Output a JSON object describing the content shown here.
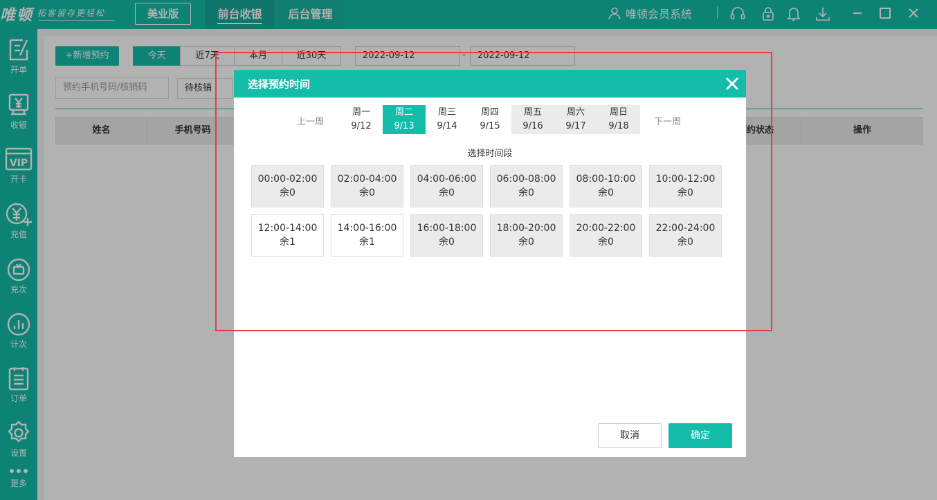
{
  "topbar": {
    "logo": "唯顿",
    "slogan": "拓客留存更轻松",
    "edition": "美业版",
    "tabs": [
      {
        "label": "前台收银"
      },
      {
        "label": "后台管理"
      }
    ],
    "system_name": "唯顿会员系统",
    "icons": [
      "headset-icon",
      "lock-icon",
      "bell-icon",
      "download-icon",
      "minimize-icon",
      "maximize-icon",
      "close-icon"
    ]
  },
  "sidebar": {
    "items": [
      {
        "label": "开单",
        "icon": "edit-order-icon"
      },
      {
        "label": "收银",
        "icon": "cash-register-icon"
      },
      {
        "label": "开卡",
        "icon": "vip-card-icon"
      },
      {
        "label": "充值",
        "icon": "recharge-icon"
      },
      {
        "label": "充次",
        "icon": "recharge-times-icon"
      },
      {
        "label": "计次",
        "icon": "bar-chart-icon"
      },
      {
        "label": "订单",
        "icon": "order-list-icon"
      },
      {
        "label": "设置",
        "icon": "gear-icon"
      },
      {
        "label": "更多",
        "icon": "more-dots-icon"
      }
    ]
  },
  "background": {
    "add_button": "+新增预约",
    "range_tabs": [
      "今天",
      "近7天",
      "本月",
      "近30天"
    ],
    "date_from": "2022-09-12",
    "date_separator": "-",
    "date_to": "2022-09-12",
    "search_placeholder": "预约手机号码/核销码",
    "status_select": "待核销",
    "columns": [
      "姓名",
      "手机号码",
      "预约状态",
      "操作"
    ]
  },
  "modal": {
    "title": "选择预约时间",
    "prev_week": "上一周",
    "next_week": "下一周",
    "days": [
      {
        "weekday": "周一",
        "date": "9/12",
        "state": "normal"
      },
      {
        "weekday": "周二",
        "date": "9/13",
        "state": "active"
      },
      {
        "weekday": "周三",
        "date": "9/14",
        "state": "normal"
      },
      {
        "weekday": "周四",
        "date": "9/15",
        "state": "normal"
      },
      {
        "weekday": "周五",
        "date": "9/16",
        "state": "grey"
      },
      {
        "weekday": "周六",
        "date": "9/17",
        "state": "grey"
      },
      {
        "weekday": "周日",
        "date": "9/18",
        "state": "grey"
      }
    ],
    "section_title": "选择时间段",
    "slots": [
      {
        "range": "00:00-02:00",
        "remain": "余0"
      },
      {
        "range": "02:00-04:00",
        "remain": "余0"
      },
      {
        "range": "04:00-06:00",
        "remain": "余0"
      },
      {
        "range": "06:00-08:00",
        "remain": "余0"
      },
      {
        "range": "08:00-10:00",
        "remain": "余0"
      },
      {
        "range": "10:00-12:00",
        "remain": "余0"
      },
      {
        "range": "12:00-14:00",
        "remain": "余1"
      },
      {
        "range": "14:00-16:00",
        "remain": "余1"
      },
      {
        "range": "16:00-18:00",
        "remain": "余0"
      },
      {
        "range": "18:00-20:00",
        "remain": "余0"
      },
      {
        "range": "20:00-22:00",
        "remain": "余0"
      },
      {
        "range": "22:00-24:00",
        "remain": "余0"
      }
    ],
    "cancel_label": "取消",
    "confirm_label": "确定"
  },
  "colors": {
    "accent": "#14bcaa",
    "highlight": "#e63e3e"
  }
}
